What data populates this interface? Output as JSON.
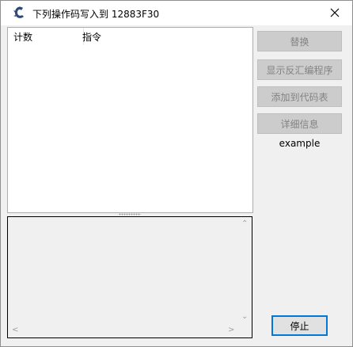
{
  "window": {
    "title": "下列操作码写入到 12883F30"
  },
  "list": {
    "columns": [
      "计数",
      "指令"
    ]
  },
  "buttons": {
    "replace": "替换",
    "show_disassembler": "显示反汇编程序",
    "add_to_code_list": "添加到代码表",
    "more_info": "详细信息",
    "stop": "停止"
  },
  "label_example": "example",
  "colors": {
    "disabled_button_bg": "#cccccc",
    "disabled_button_text": "#838383",
    "focus_border": "#0078d7"
  },
  "icons": {
    "app": "cheat-engine-icon",
    "close": "close-icon"
  }
}
